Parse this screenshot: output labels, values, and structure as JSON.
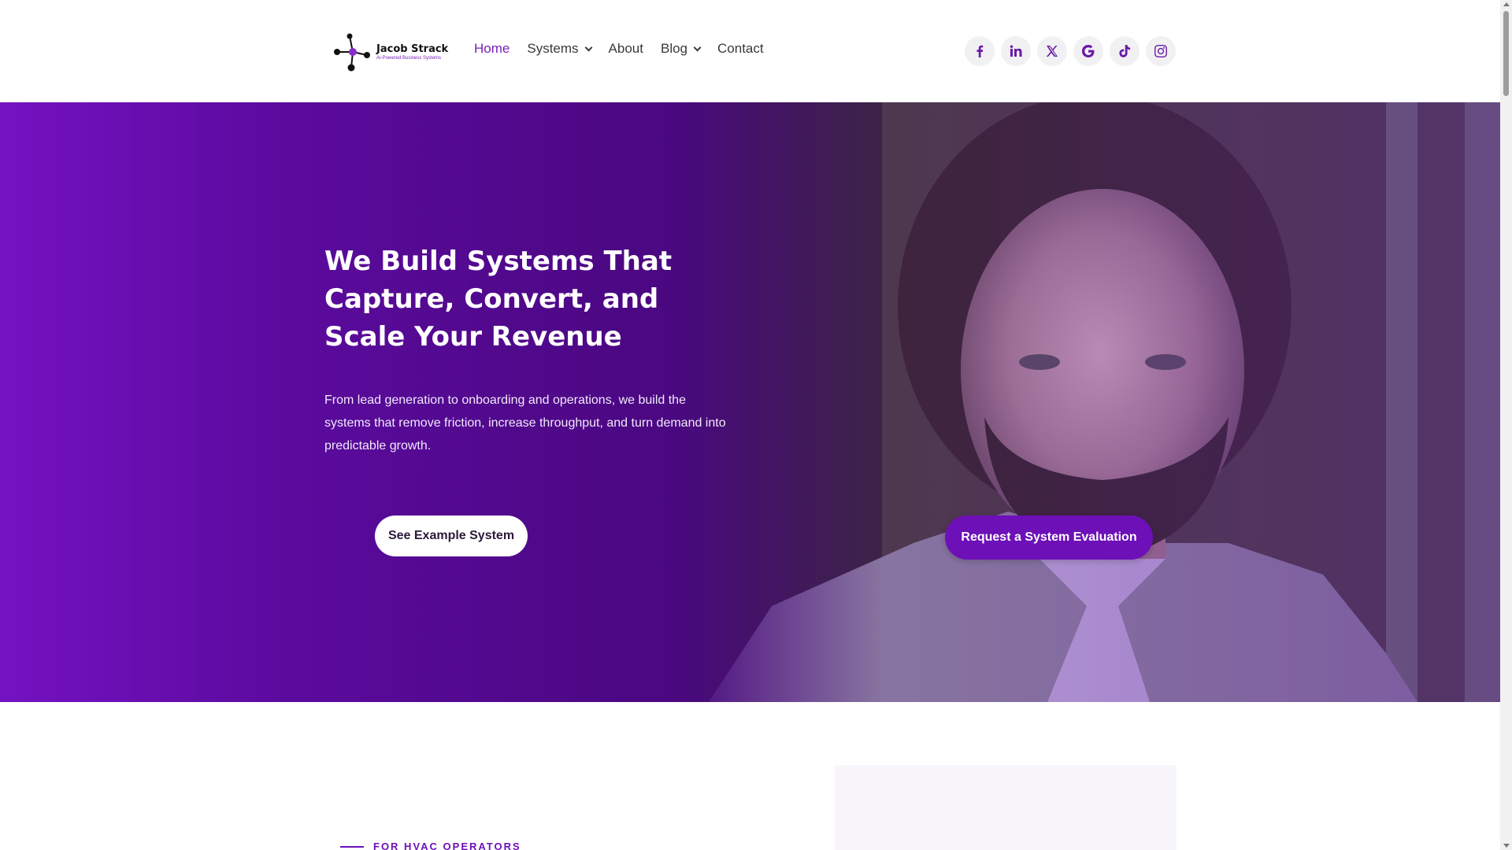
{
  "brand": {
    "name": "Jacob Strack",
    "tagline": "AI-Powered Business Systems",
    "accent": "#7a1fb8"
  },
  "nav": {
    "items": [
      {
        "label": "Home",
        "active": true,
        "dropdown": false
      },
      {
        "label": "Systems",
        "active": false,
        "dropdown": true
      },
      {
        "label": "About",
        "active": false,
        "dropdown": false
      },
      {
        "label": "Blog",
        "active": false,
        "dropdown": true
      },
      {
        "label": "Contact",
        "active": false,
        "dropdown": false
      }
    ]
  },
  "socials": [
    "facebook-icon",
    "linkedin-icon",
    "x-icon",
    "google-icon",
    "tiktok-icon",
    "instagram-icon"
  ],
  "hero": {
    "title": "We Build Systems That Capture, Convert, and Scale Your Revenue",
    "subtitle": "From lead generation to onboarding and operations, we build the systems that remove friction, increase throughput, and turn demand into predictable growth.",
    "primary_cta": "See Example System",
    "secondary_cta": "Request a System Evaluation",
    "gradient_color": "#7412c2"
  },
  "section": {
    "eyebrow": "FOR HVAC OPERATORS"
  }
}
